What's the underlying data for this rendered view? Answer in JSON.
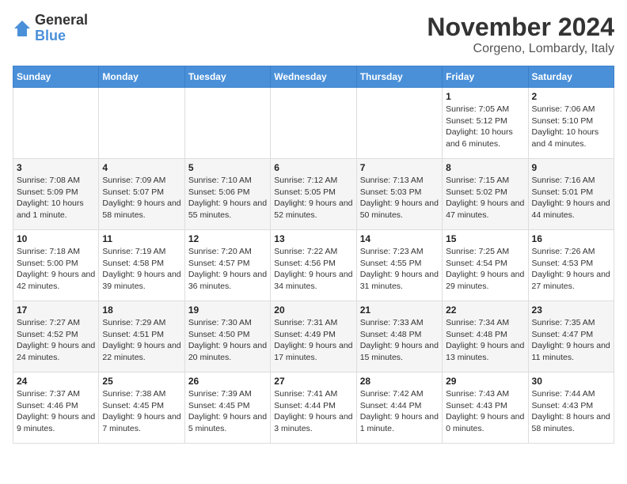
{
  "logo": {
    "general": "General",
    "blue": "Blue"
  },
  "title": "November 2024",
  "location": "Corgeno, Lombardy, Italy",
  "days_of_week": [
    "Sunday",
    "Monday",
    "Tuesday",
    "Wednesday",
    "Thursday",
    "Friday",
    "Saturday"
  ],
  "weeks": [
    [
      {
        "day": "",
        "info": ""
      },
      {
        "day": "",
        "info": ""
      },
      {
        "day": "",
        "info": ""
      },
      {
        "day": "",
        "info": ""
      },
      {
        "day": "",
        "info": ""
      },
      {
        "day": "1",
        "info": "Sunrise: 7:05 AM\nSunset: 5:12 PM\nDaylight: 10 hours and 6 minutes."
      },
      {
        "day": "2",
        "info": "Sunrise: 7:06 AM\nSunset: 5:10 PM\nDaylight: 10 hours and 4 minutes."
      }
    ],
    [
      {
        "day": "3",
        "info": "Sunrise: 7:08 AM\nSunset: 5:09 PM\nDaylight: 10 hours and 1 minute."
      },
      {
        "day": "4",
        "info": "Sunrise: 7:09 AM\nSunset: 5:07 PM\nDaylight: 9 hours and 58 minutes."
      },
      {
        "day": "5",
        "info": "Sunrise: 7:10 AM\nSunset: 5:06 PM\nDaylight: 9 hours and 55 minutes."
      },
      {
        "day": "6",
        "info": "Sunrise: 7:12 AM\nSunset: 5:05 PM\nDaylight: 9 hours and 52 minutes."
      },
      {
        "day": "7",
        "info": "Sunrise: 7:13 AM\nSunset: 5:03 PM\nDaylight: 9 hours and 50 minutes."
      },
      {
        "day": "8",
        "info": "Sunrise: 7:15 AM\nSunset: 5:02 PM\nDaylight: 9 hours and 47 minutes."
      },
      {
        "day": "9",
        "info": "Sunrise: 7:16 AM\nSunset: 5:01 PM\nDaylight: 9 hours and 44 minutes."
      }
    ],
    [
      {
        "day": "10",
        "info": "Sunrise: 7:18 AM\nSunset: 5:00 PM\nDaylight: 9 hours and 42 minutes."
      },
      {
        "day": "11",
        "info": "Sunrise: 7:19 AM\nSunset: 4:58 PM\nDaylight: 9 hours and 39 minutes."
      },
      {
        "day": "12",
        "info": "Sunrise: 7:20 AM\nSunset: 4:57 PM\nDaylight: 9 hours and 36 minutes."
      },
      {
        "day": "13",
        "info": "Sunrise: 7:22 AM\nSunset: 4:56 PM\nDaylight: 9 hours and 34 minutes."
      },
      {
        "day": "14",
        "info": "Sunrise: 7:23 AM\nSunset: 4:55 PM\nDaylight: 9 hours and 31 minutes."
      },
      {
        "day": "15",
        "info": "Sunrise: 7:25 AM\nSunset: 4:54 PM\nDaylight: 9 hours and 29 minutes."
      },
      {
        "day": "16",
        "info": "Sunrise: 7:26 AM\nSunset: 4:53 PM\nDaylight: 9 hours and 27 minutes."
      }
    ],
    [
      {
        "day": "17",
        "info": "Sunrise: 7:27 AM\nSunset: 4:52 PM\nDaylight: 9 hours and 24 minutes."
      },
      {
        "day": "18",
        "info": "Sunrise: 7:29 AM\nSunset: 4:51 PM\nDaylight: 9 hours and 22 minutes."
      },
      {
        "day": "19",
        "info": "Sunrise: 7:30 AM\nSunset: 4:50 PM\nDaylight: 9 hours and 20 minutes."
      },
      {
        "day": "20",
        "info": "Sunrise: 7:31 AM\nSunset: 4:49 PM\nDaylight: 9 hours and 17 minutes."
      },
      {
        "day": "21",
        "info": "Sunrise: 7:33 AM\nSunset: 4:48 PM\nDaylight: 9 hours and 15 minutes."
      },
      {
        "day": "22",
        "info": "Sunrise: 7:34 AM\nSunset: 4:48 PM\nDaylight: 9 hours and 13 minutes."
      },
      {
        "day": "23",
        "info": "Sunrise: 7:35 AM\nSunset: 4:47 PM\nDaylight: 9 hours and 11 minutes."
      }
    ],
    [
      {
        "day": "24",
        "info": "Sunrise: 7:37 AM\nSunset: 4:46 PM\nDaylight: 9 hours and 9 minutes."
      },
      {
        "day": "25",
        "info": "Sunrise: 7:38 AM\nSunset: 4:45 PM\nDaylight: 9 hours and 7 minutes."
      },
      {
        "day": "26",
        "info": "Sunrise: 7:39 AM\nSunset: 4:45 PM\nDaylight: 9 hours and 5 minutes."
      },
      {
        "day": "27",
        "info": "Sunrise: 7:41 AM\nSunset: 4:44 PM\nDaylight: 9 hours and 3 minutes."
      },
      {
        "day": "28",
        "info": "Sunrise: 7:42 AM\nSunset: 4:44 PM\nDaylight: 9 hours and 1 minute."
      },
      {
        "day": "29",
        "info": "Sunrise: 7:43 AM\nSunset: 4:43 PM\nDaylight: 9 hours and 0 minutes."
      },
      {
        "day": "30",
        "info": "Sunrise: 7:44 AM\nSunset: 4:43 PM\nDaylight: 8 hours and 58 minutes."
      }
    ]
  ]
}
